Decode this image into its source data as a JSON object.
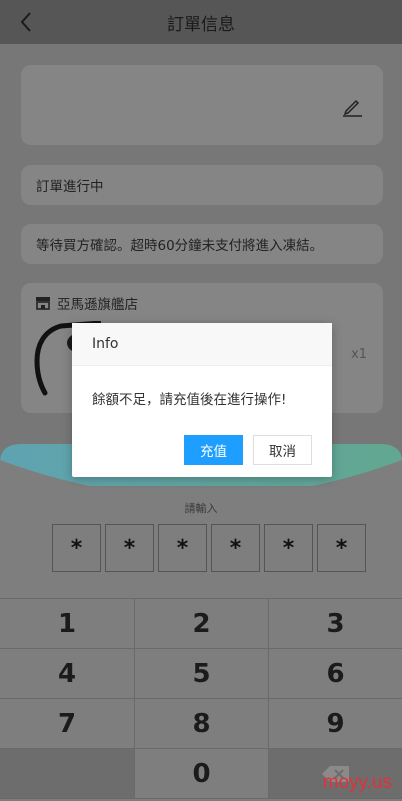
{
  "header": {
    "title": "訂單信息"
  },
  "order": {
    "status_text": "訂單進行中",
    "note_text": "等待買方確認。超時60分鐘未支付將進入凍結。",
    "store_name": "亞馬遜旗艦店",
    "quantity": "x1"
  },
  "payment_sheet": {
    "prompt": "請輸入",
    "password_chars": [
      "*",
      "*",
      "*",
      "*",
      "*",
      "*"
    ],
    "keys": [
      "1",
      "2",
      "3",
      "4",
      "5",
      "6",
      "7",
      "8",
      "9",
      "",
      "0",
      ""
    ],
    "delete_key_icon": "backspace-icon",
    "accent_colors": [
      "#5fa3b1",
      "#62a790"
    ]
  },
  "dialog": {
    "title": "Info",
    "message": "餘額不足，請充值後在進行操作!",
    "confirm_label": "充值",
    "cancel_label": "取消",
    "confirm_color": "#1e9fff"
  },
  "watermark": "moyy.us"
}
